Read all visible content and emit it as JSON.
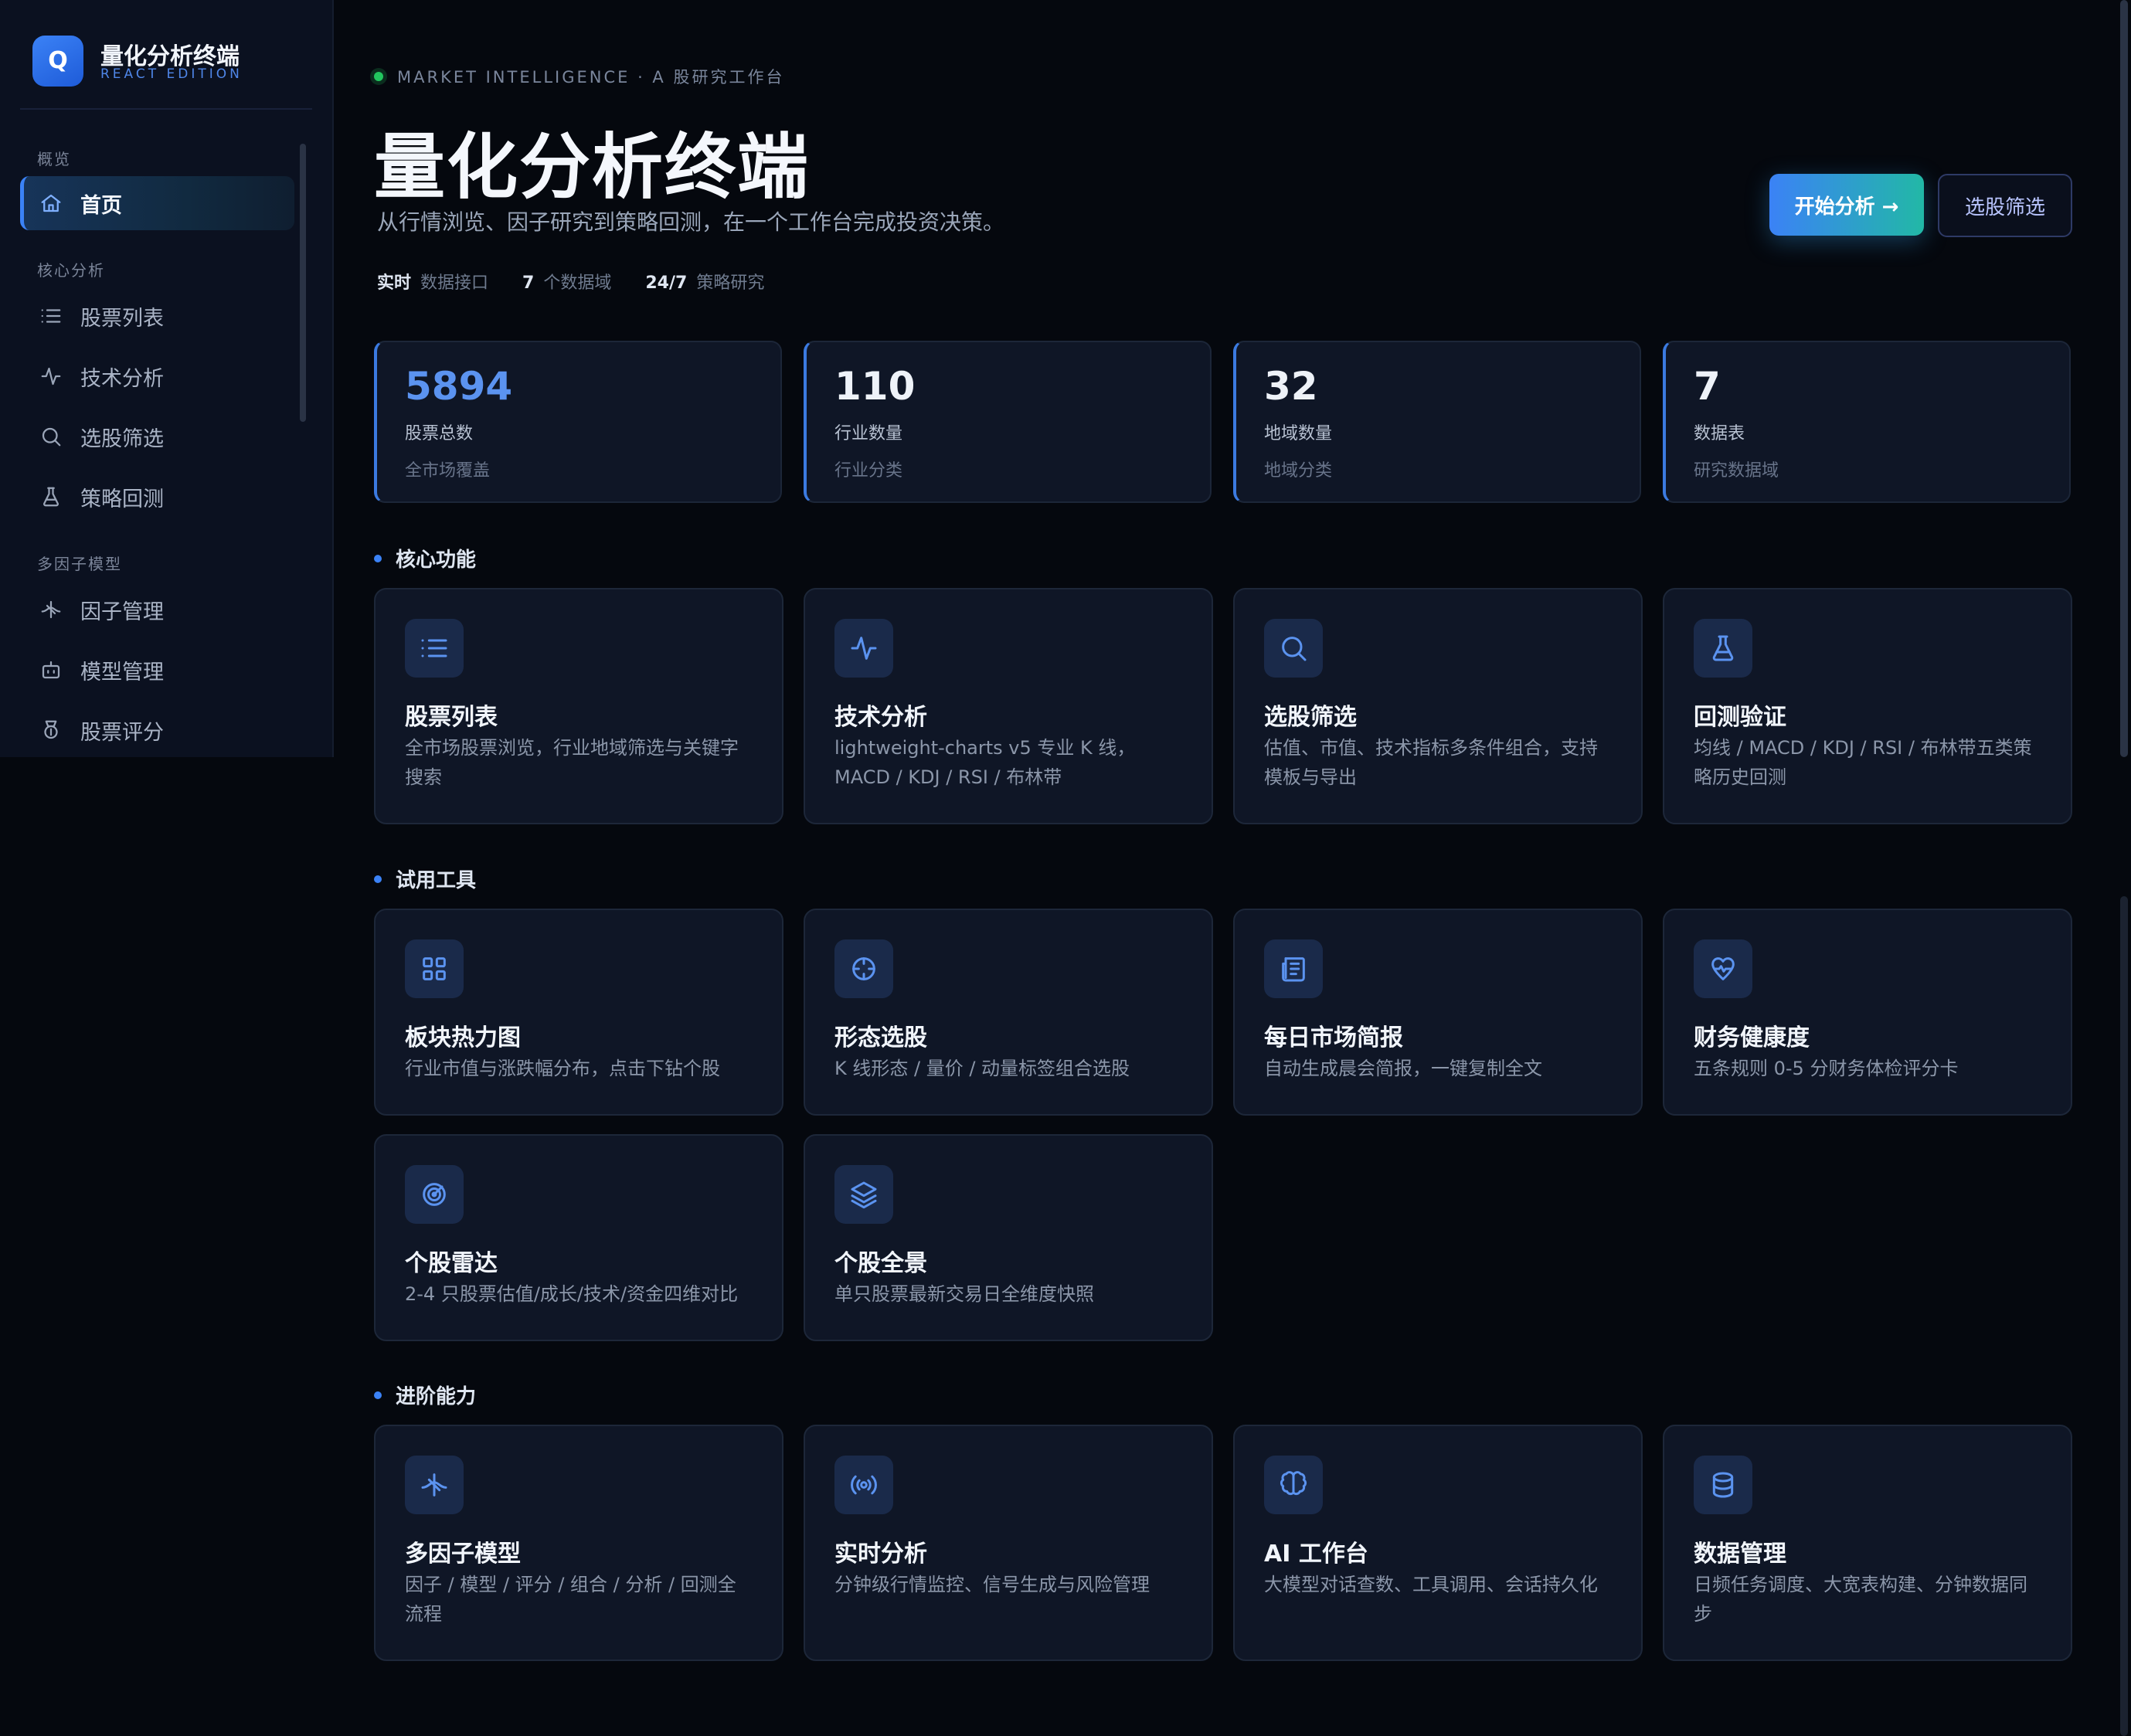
{
  "brand": {
    "logo": "Q",
    "title": "量化分析终端",
    "subtitle": "REACT EDITION"
  },
  "sidebar": {
    "sections": [
      {
        "title": "概览",
        "items": [
          {
            "label": "首页",
            "icon": "home-icon",
            "active": true
          }
        ]
      },
      {
        "title": "核心分析",
        "items": [
          {
            "label": "股票列表",
            "icon": "list-icon"
          },
          {
            "label": "技术分析",
            "icon": "activity-icon"
          },
          {
            "label": "选股筛选",
            "icon": "search-icon"
          },
          {
            "label": "策略回测",
            "icon": "flask-icon"
          }
        ]
      },
      {
        "title": "多因子模型",
        "items": [
          {
            "label": "因子管理",
            "icon": "dna-icon"
          },
          {
            "label": "模型管理",
            "icon": "bot-icon"
          },
          {
            "label": "股票评分",
            "icon": "award-icon"
          }
        ]
      }
    ]
  },
  "hero": {
    "eyebrow": "MARKET INTELLIGENCE · A 股研究工作台",
    "title": "量化分析终端",
    "subtitle": "从行情浏览、因子研究到策略回测，在一个工作台完成投资决策。",
    "metrics": [
      {
        "value": "实时",
        "label": "数据接口"
      },
      {
        "value": "7",
        "label": "个数据域"
      },
      {
        "value": "24/7",
        "label": "策略研究"
      }
    ],
    "primary_button": "开始分析 →",
    "secondary_button": "选股筛选"
  },
  "stats": [
    {
      "value": "5894",
      "label": "股票总数",
      "sub": "全市场覆盖"
    },
    {
      "value": "110",
      "label": "行业数量",
      "sub": "行业分类"
    },
    {
      "value": "32",
      "label": "地域数量",
      "sub": "地域分类"
    },
    {
      "value": "7",
      "label": "数据表",
      "sub": "研究数据域"
    }
  ],
  "sections": {
    "core": {
      "title": "核心功能",
      "cards": [
        {
          "icon": "list-icon",
          "title": "股票列表",
          "desc": "全市场股票浏览，行业地域筛选与关键字搜索"
        },
        {
          "icon": "activity-icon",
          "title": "技术分析",
          "desc": "lightweight-charts v5 专业 K 线，MACD / KDJ / RSI / 布林带"
        },
        {
          "icon": "search-icon",
          "title": "选股筛选",
          "desc": "估值、市值、技术指标多条件组合，支持模板与导出"
        },
        {
          "icon": "flask-icon",
          "title": "回测验证",
          "desc": "均线 / MACD / KDJ / RSI / 布林带五类策略历史回测"
        }
      ]
    },
    "tools": {
      "title": "试用工具",
      "cards": [
        {
          "icon": "grid-icon",
          "title": "板块热力图",
          "desc": "行业市值与涨跌幅分布，点击下钻个股"
        },
        {
          "icon": "crosshair-icon",
          "title": "形态选股",
          "desc": "K 线形态 / 量价 / 动量标签组合选股"
        },
        {
          "icon": "newspaper-icon",
          "title": "每日市场简报",
          "desc": "自动生成晨会简报，一键复制全文"
        },
        {
          "icon": "heart-pulse-icon",
          "title": "财务健康度",
          "desc": "五条规则 0-5 分财务体检评分卡"
        },
        {
          "icon": "radar-icon",
          "title": "个股雷达",
          "desc": "2-4 只股票估值/成长/技术/资金四维对比"
        },
        {
          "icon": "layers-icon",
          "title": "个股全景",
          "desc": "单只股票最新交易日全维度快照"
        }
      ]
    },
    "advanced": {
      "title": "进阶能力",
      "cards": [
        {
          "icon": "dna-icon",
          "title": "多因子模型",
          "desc": "因子 / 模型 / 评分 / 组合 / 分析 / 回测全流程"
        },
        {
          "icon": "radio-icon",
          "title": "实时分析",
          "desc": "分钟级行情监控、信号生成与风险管理"
        },
        {
          "icon": "brain-icon",
          "title": "AI 工作台",
          "desc": "大模型对话查数、工具调用、会话持久化"
        },
        {
          "icon": "database-icon",
          "title": "数据管理",
          "desc": "日频任务调度、大宽表构建、分钟数据同步"
        }
      ]
    }
  },
  "colors": {
    "accent": "#3b82f6",
    "teal": "#22b8a6",
    "background": "#05080e",
    "card": "#0f1626"
  }
}
